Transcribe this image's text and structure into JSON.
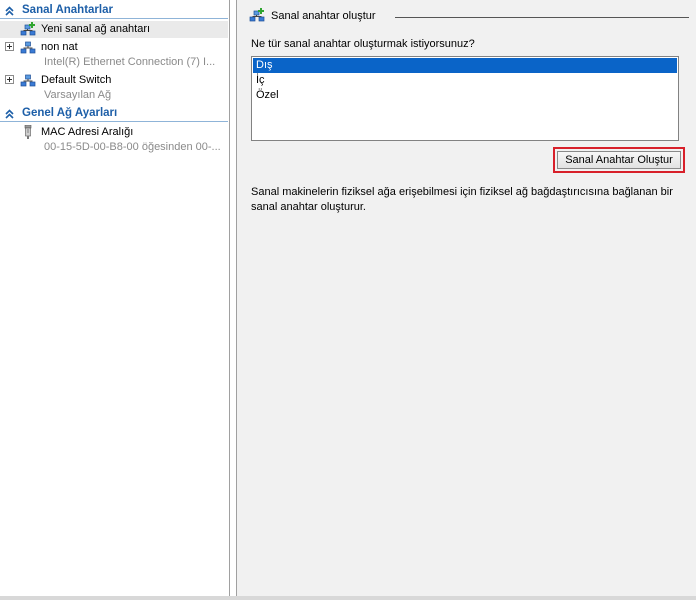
{
  "sidebar": {
    "sections": [
      {
        "title": "Sanal Anahtarlar"
      },
      {
        "title": "Genel Ağ Ayarları"
      }
    ],
    "items": [
      {
        "label": "Yeni sanal ağ anahtarı",
        "sublabel": ""
      },
      {
        "label": "non nat",
        "sublabel": "Intel(R) Ethernet Connection (7) I..."
      },
      {
        "label": "Default Switch",
        "sublabel": "Varsayılan Ağ"
      },
      {
        "label": "MAC Adresi Aralığı",
        "sublabel": "00-15-5D-00-B8-00 öğesinden 00-..."
      }
    ],
    "selected_item": 0
  },
  "panel": {
    "group_title": "Sanal anahtar oluştur",
    "question": "Ne tür sanal anahtar oluşturmak istiyorsunuz?",
    "switch_types": [
      "Dış",
      "İç",
      "Özel"
    ],
    "selected_type": "Dış",
    "create_button_label": "Sanal Anahtar Oluştur",
    "description": "Sanal makinelerin fiziksel ağa erişebilmesi için fiziksel ağ bağdaştırıcısına bağlanan bir sanal anahtar oluşturur."
  },
  "colors": {
    "section_title": "#1d5fa8",
    "selection": "#0a64c8",
    "highlight_border": "#d8202a"
  },
  "icons": {
    "collapse": "double-chevron-up-icon",
    "new_switch": "network-add-icon",
    "switch": "network-switch-icon",
    "mac": "adapter-plug-icon"
  }
}
